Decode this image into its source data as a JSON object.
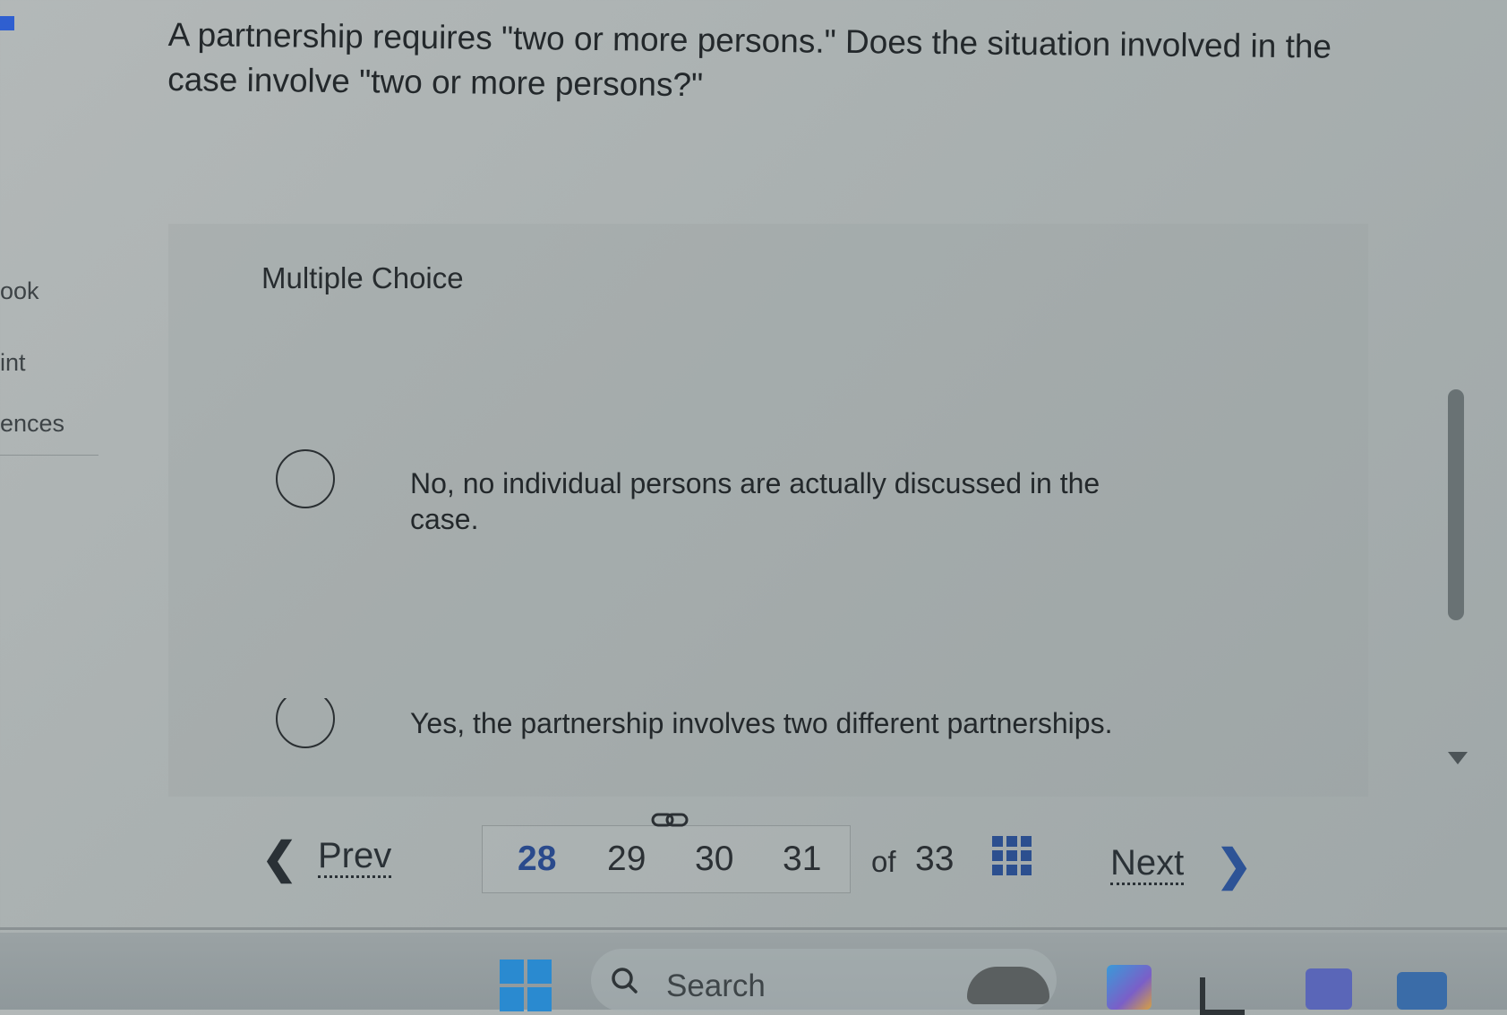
{
  "question": {
    "text": "A partnership requires \"two or more persons.\" Does the situation involved in the case involve \"two or more persons?\""
  },
  "left_nav": {
    "items": [
      {
        "label": "ook"
      },
      {
        "label": "int"
      },
      {
        "label": "ences"
      }
    ]
  },
  "multiple_choice": {
    "label": "Multiple Choice",
    "options": [
      {
        "text": "No, no individual persons are actually discussed in the case.",
        "selected": false
      },
      {
        "text": "Yes, the partnership involves two different partnerships.",
        "selected": false
      }
    ]
  },
  "pager": {
    "prev_label": "Prev",
    "pages": [
      {
        "label": "28",
        "current": true
      },
      {
        "label": "29",
        "current": false
      },
      {
        "label": "30",
        "current": false
      },
      {
        "label": "31",
        "current": false
      }
    ],
    "of_label": "of",
    "total": "33",
    "next_label": "Next"
  },
  "taskbar": {
    "search_label": "Search"
  },
  "colors": {
    "accent": "#2c4f8f",
    "windows_blue": "#2a8ad0"
  }
}
